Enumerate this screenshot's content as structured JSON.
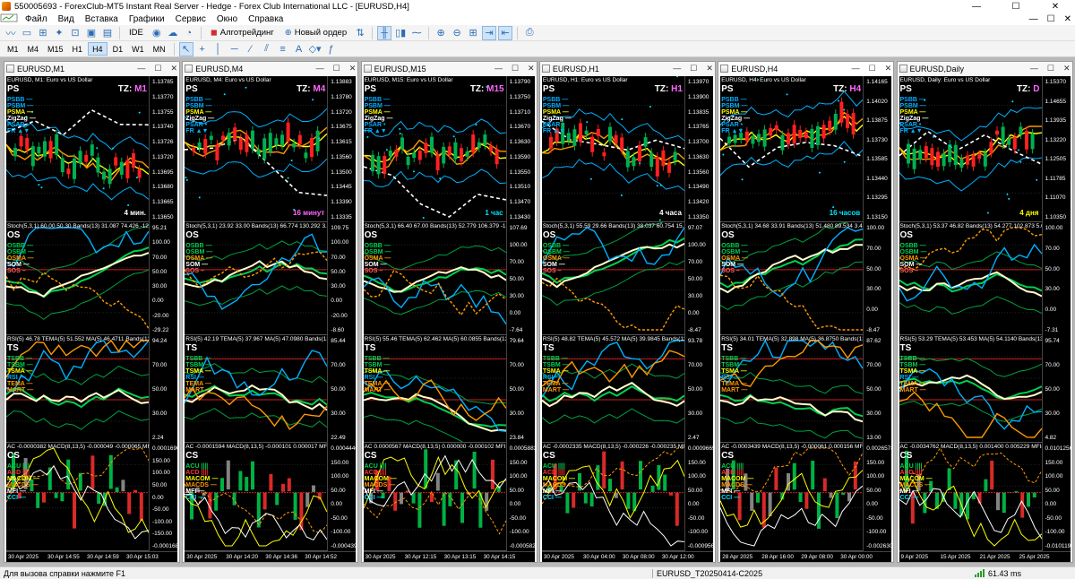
{
  "window": {
    "title": "550005693 - ForexClub-MT5 Instant Real Server - Hedge - Forex Club International LLC - [EURUSD,H4]",
    "minimize": "—",
    "maximize": "☐",
    "close": "✕"
  },
  "menu": {
    "items": [
      "Файл",
      "Вид",
      "Вставка",
      "Графики",
      "Сервис",
      "Окно",
      "Справка"
    ],
    "right_controls": [
      "—",
      "☐",
      "✕"
    ]
  },
  "toolbar1": {
    "ide": "IDE",
    "algotrading": "Алготрейдинг",
    "new_order": "Новый ордер"
  },
  "toolbar2": {
    "timeframes": [
      "M1",
      "M4",
      "M15",
      "H1",
      "H4",
      "D1",
      "W1",
      "MN"
    ],
    "active_timeframe": "H4"
  },
  "indicator_labels": {
    "ps": "PS",
    "ps_lines": [
      "PSBB —",
      "PSBM —",
      "PSMA —",
      "ZigZag —",
      "PSAR •",
      "FR ▲▼"
    ],
    "os": "OS",
    "os_lines": [
      "OSBB —",
      "OSBM —",
      "OSMA —",
      "SOM —",
      "SOS –"
    ],
    "ts": "TS",
    "ts_lines": [
      "TSBB —",
      "TSBM —",
      "TSMA —",
      "RSI —",
      "TEMA —",
      "MART —"
    ],
    "cs": "CS",
    "cs_lines": [
      "ACU ||||",
      "ACD ||||",
      "MACOM —",
      "MACDS —",
      "MFI —",
      "CCI —"
    ]
  },
  "charts": [
    {
      "title": "EURUSD,M1",
      "header": "EURUSD, M1:  Euro vs US Dollar",
      "tz": "M1",
      "tf_label": "4 мин.",
      "tf_color": "#ffffff",
      "prices": [
        "1.13785",
        "1.13770",
        "1.13755",
        "1.13740",
        "1.13726",
        "1.13720",
        "1.13695",
        "1.13680",
        "1.13665",
        "1.13650"
      ],
      "os_header": "Stoch(5,3,1) 60.00 50.30 Bands(13) 31.087 74.426 -12.072",
      "os_axis": [
        "95.21",
        "100.00",
        "70.00",
        "50.00",
        "30.00",
        "0.00",
        "-20.00",
        "-29.22"
      ],
      "ts_header": "RSI(5) 46.78 TEMA(5) 51.552 MA(5) 46.4711 Bands(13) 60.2",
      "ts_axis": [
        "94.24",
        "70.00",
        "50.00",
        "30.00",
        "2.24"
      ],
      "cs_header": "AC -0.0000382 MACD(8,13,5) -0.000049 -0.000065 MFI(3)",
      "cs_axis": [
        "0.0001690",
        "150.00",
        "100.00",
        "50.00",
        "0.00",
        "-50.00",
        "-100.00",
        "-150.00",
        "-0.0001681"
      ],
      "dates": [
        "30 Apr 2025",
        "30 Apr 14:55",
        "30 Apr 14:59",
        "30 Apr 15:03"
      ]
    },
    {
      "title": "EURUSD,M4",
      "header": "EURUSD, M4:  Euro vs US Dollar",
      "tz": "M4",
      "tf_label": "16 минут",
      "tf_color": "#ff66ff",
      "prices": [
        "1.13883",
        "1.13780",
        "1.13720",
        "1.13675",
        "1.13615",
        "1.13560",
        "1.13500",
        "1.13445",
        "1.13390",
        "1.13335"
      ],
      "os_header": "Stoch(5,3,1) 23.92 33.00 Bands(13) 66.774 130.292 3.256 MF",
      "os_axis": [
        "109.75",
        "100.00",
        "70.00",
        "50.00",
        "30.00",
        "0.00",
        "-20.00",
        "-8.60"
      ],
      "ts_header": "RSI(5) 42.19 TEMA(5) 37.967 MA(5) 47.0980 Bands(13) 55.52",
      "ts_axis": [
        "85.44",
        "70.00",
        "50.00",
        "30.00",
        "22.49"
      ],
      "cs_header": "AC -0.0001594 MACD(8,13,5) -0.000101 0.000017 MFI(3)",
      "cs_axis": [
        "0.0004440",
        "150.00",
        "100.00",
        "50.00",
        "0.00",
        "-50.00",
        "-100.00",
        "-0.0004395"
      ],
      "dates": [
        "30 Apr 2025",
        "30 Apr 14:20",
        "30 Apr 14:36",
        "30 Apr 14:52"
      ]
    },
    {
      "title": "EURUSD,M15",
      "header": "EURUSD, M15:  Euro vs US Dollar",
      "tz": "M15",
      "tf_label": "1 час",
      "tf_color": "#00e5ff",
      "prices": [
        "1.13790",
        "1.13750",
        "1.13710",
        "1.13670",
        "1.13630",
        "1.13590",
        "1.13550",
        "1.13510",
        "1.13470",
        "1.13430"
      ],
      "os_header": "Stoch(5,3,1) 66.40 67.00 Bands(13) 52.779 106.379 -1.321",
      "os_axis": [
        "107.69",
        "100.00",
        "70.00",
        "50.00",
        "30.00",
        "0.00",
        "-7.64"
      ],
      "ts_header": "RSI(5) 55.46 TEMA(5) 62.462 MA(5) 60.0855 Bands(13) 60",
      "ts_axis": [
        "79.64",
        "70.00",
        "50.00",
        "30.00",
        "23.84"
      ],
      "cs_header": "AC 0.0000567 MACD(8,13,5) 0.000000 -0.000102 MFI(3)",
      "cs_axis": [
        "0.0005883",
        "150.00",
        "100.00",
        "50.00",
        "0.00",
        "-50.00",
        "-100.00",
        "-0.0005822"
      ],
      "dates": [
        "30 Apr 2025",
        "30 Apr 12:15",
        "30 Apr 13:15",
        "30 Apr 14:15"
      ]
    },
    {
      "title": "EURUSD,H1",
      "header": "EURUSD, H1:  Euro vs US Dollar",
      "tz": "H1",
      "tf_label": "4 часа",
      "tf_color": "#ffffff",
      "prices": [
        "1.13970",
        "1.13900",
        "1.13835",
        "1.13765",
        "1.13700",
        "1.13630",
        "1.13560",
        "1.13490",
        "1.13420",
        "1.13350"
      ],
      "os_header": "Stoch(5,3,1) 55.59 29.66 Bands(13) 38.037 60.754 15.381",
      "os_axis": [
        "97.07",
        "100.00",
        "70.00",
        "50.00",
        "30.00",
        "0.00",
        "-8.47"
      ],
      "ts_header": "RSI(5) 48.82 TEMA(5) 45.572 MA(5) 39.9845 Bands(13) 45",
      "ts_axis": [
        "93.78",
        "70.00",
        "50.00",
        "30.00",
        "2.47"
      ],
      "cs_header": "AC -0.0002335 MACD(8,13,5) -0.000226 -0.000235 MFI(3)",
      "cs_axis": [
        "0.0009665",
        "150.00",
        "100.00",
        "50.00",
        "0.00",
        "-50.00",
        "-100.00",
        "-0.0009565"
      ],
      "dates": [
        "30 Apr 2025",
        "30 Apr 04:00",
        "30 Apr 08:00",
        "30 Apr 12:00"
      ]
    },
    {
      "title": "EURUSD,H4",
      "header": "EURUSD, H4:  Euro vs US Dollar",
      "tz": "H4",
      "tf_label": "16 часов",
      "tf_color": "#00e5ff",
      "prices": [
        "1.14165",
        "1.14020",
        "1.13875",
        "1.13730",
        "1.13585",
        "1.13440",
        "1.13295",
        "1.13150"
      ],
      "os_header": "Stoch(5,3,1) 34.68 33.91 Bands(13) 51.480 89.534 3.427 M",
      "os_axis": [
        "100.00",
        "70.00",
        "50.00",
        "30.00",
        "0.00",
        "-8.47"
      ],
      "ts_header": "RSI(5) 34.01 TEMA(5) 32.898 MA(5) 36.8750 Bands(13) 46",
      "ts_axis": [
        "87.62",
        "70.00",
        "50.00",
        "30.00",
        "13.00"
      ],
      "cs_header": "AC -0.0003439 MACD(8,13,5) -0.000061 0.000156 MFI(3)",
      "cs_axis": [
        "0.0026578",
        "150.00",
        "100.00",
        "50.00",
        "0.00",
        "-50.00",
        "-100.00",
        "-0.0026304"
      ],
      "dates": [
        "28 Apr 2025",
        "28 Apr 16:00",
        "29 Apr 08:00",
        "30 Apr 00:00"
      ]
    },
    {
      "title": "EURUSD,Daily",
      "header": "EURUSD, Daily:  Euro vs US Dollar",
      "tz": "D",
      "tf_label": "4 дня",
      "tf_color": "#ffff00",
      "prices": [
        "1.15370",
        "1.14655",
        "1.13935",
        "1.13220",
        "1.12505",
        "1.11785",
        "1.11070",
        "1.10350"
      ],
      "os_header": "Stoch(5,3,1) 53.37 46.82 Bands(13) 54.277 102.873 5.680 M",
      "os_axis": [
        "100.00",
        "70.00",
        "50.00",
        "30.00",
        "0.00",
        "-7.31"
      ],
      "ts_header": "RSI(5) 53.29 TEMA(5) 53.453 MA(5) 54.1140 Bands(13) 59",
      "ts_axis": [
        "95.74",
        "70.00",
        "50.00",
        "30.00",
        "4.82"
      ],
      "cs_header": "AC -0.0034762 MACD(8,13,5) 0.001400 0.005229 MFI(3)",
      "cs_axis": [
        "0.0101256",
        "150.00",
        "100.00",
        "50.00",
        "0.00",
        "-50.00",
        "-100.00",
        "-0.0101195"
      ],
      "dates": [
        "9 Apr 2025",
        "15 Apr 2025",
        "21 Apr 2025",
        "25 Apr 2025"
      ]
    }
  ],
  "status": {
    "help": "Для вызова справки нажмите F1",
    "profile": "EURUSD_T20250414-C2025",
    "ping": "61.43 ms"
  },
  "colors": {
    "up_candle": "#00b050",
    "down_candle": "#ff2020",
    "psbb": "#00b0ff",
    "psbm": "#ffff00",
    "psma": "#ff9900",
    "level_line": "#cc2020",
    "cci": "#00e5ff"
  }
}
